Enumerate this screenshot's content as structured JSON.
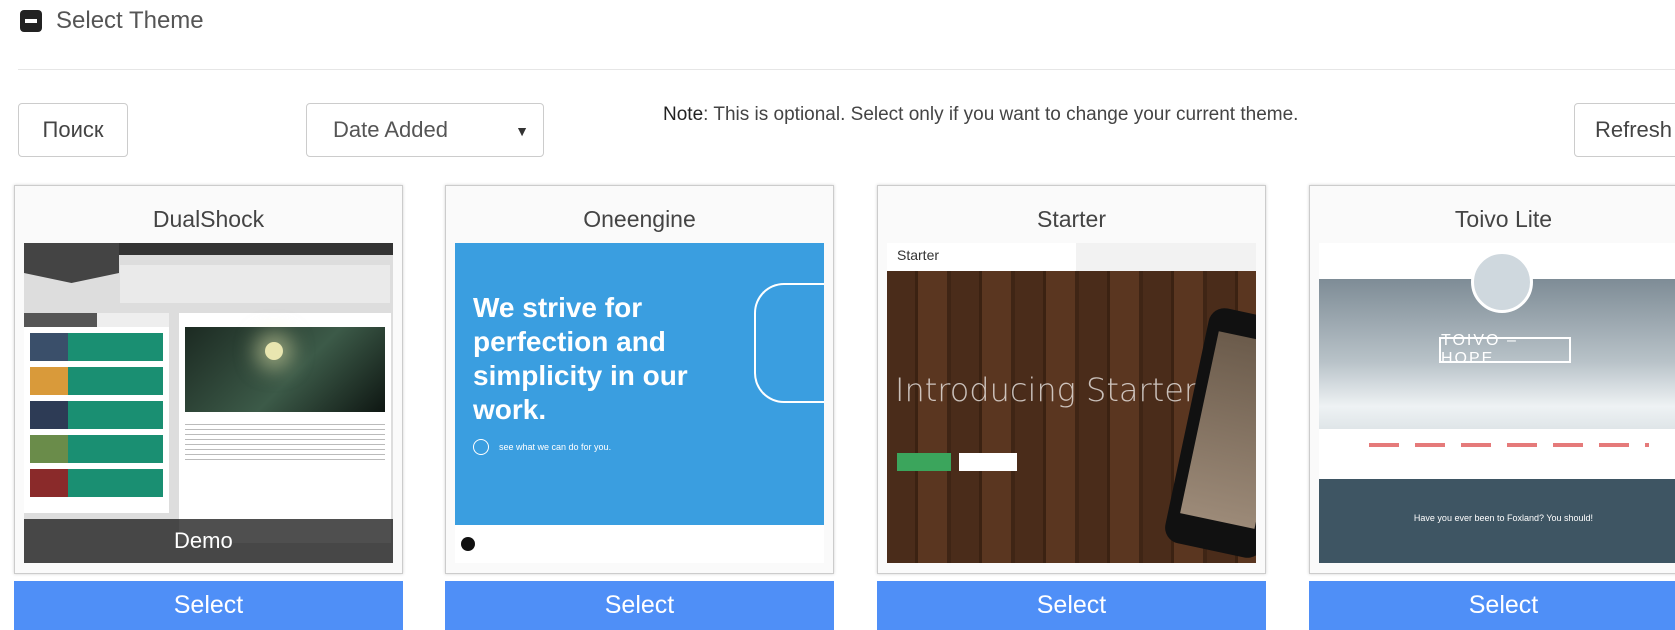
{
  "header": {
    "title": "Select Theme"
  },
  "toolbar": {
    "search_label": "Поиск",
    "sort_value": "Date Added",
    "note_prefix": "Note",
    "note_text": ": This is optional. Select only if you want to change your current theme.",
    "refresh_label": "Refresh"
  },
  "themes": [
    {
      "name": "DualShock",
      "select_label": "Select",
      "demo_label": "Demo"
    },
    {
      "name": "Oneengine",
      "select_label": "Select",
      "preview_headline": "We strive for perfection and simplicity in our work.",
      "preview_sub": "see what we can do for you."
    },
    {
      "name": "Starter",
      "select_label": "Select",
      "preview_brand": "Starter",
      "preview_headline": "Introducing Starter"
    },
    {
      "name": "Toivo Lite",
      "select_label": "Select",
      "preview_title": "TOIVO – HOPE",
      "preview_footer": "Have you ever been to Foxland? You should!"
    }
  ],
  "colors": {
    "accent": "#4f8ff7",
    "text": "#444444",
    "border": "#cccccc"
  }
}
